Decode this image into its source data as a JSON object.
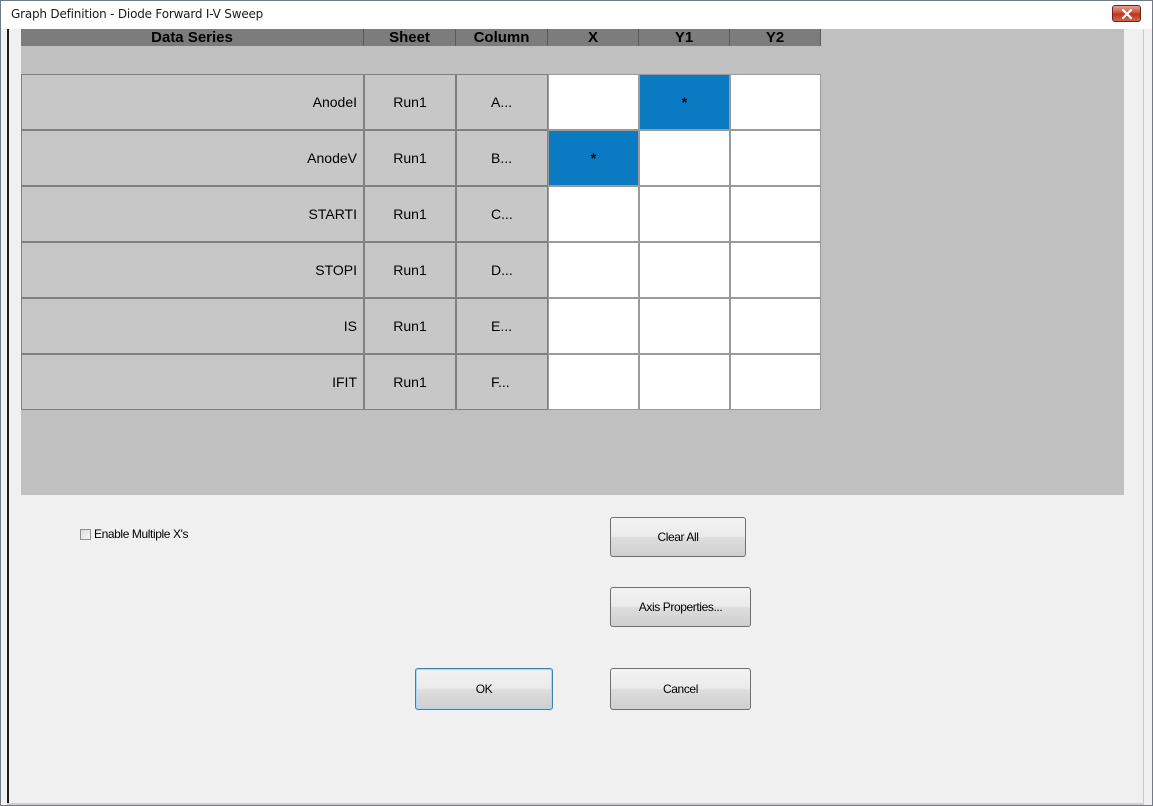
{
  "window": {
    "title": "Graph Definition - Diode Forward I-V Sweep"
  },
  "grid": {
    "headers": {
      "data_series": "Data Series",
      "sheet": "Sheet",
      "column": "Column",
      "x": "X",
      "y1": "Y1",
      "y2": "Y2"
    },
    "rows": [
      {
        "name": "AnodeI",
        "sheet": "Run1",
        "column": "A...",
        "x": "",
        "y1": "*",
        "y2": ""
      },
      {
        "name": "AnodeV",
        "sheet": "Run1",
        "column": "B...",
        "x": "*",
        "y1": "",
        "y2": ""
      },
      {
        "name": "STARTI",
        "sheet": "Run1",
        "column": "C...",
        "x": "",
        "y1": "",
        "y2": ""
      },
      {
        "name": "STOPI",
        "sheet": "Run1",
        "column": "D...",
        "x": "",
        "y1": "",
        "y2": ""
      },
      {
        "name": "IS",
        "sheet": "Run1",
        "column": "E...",
        "x": "",
        "y1": "",
        "y2": ""
      },
      {
        "name": "IFIT",
        "sheet": "Run1",
        "column": "F...",
        "x": "",
        "y1": "",
        "y2": ""
      }
    ],
    "selected_color": "#0a7bc2"
  },
  "options": {
    "enable_multiple_x_label": "Enable Multiple X's",
    "enable_multiple_x_checked": false
  },
  "buttons": {
    "clear_all": "Clear All",
    "axis_properties": "Axis Properties...",
    "ok": "OK",
    "cancel": "Cancel"
  }
}
